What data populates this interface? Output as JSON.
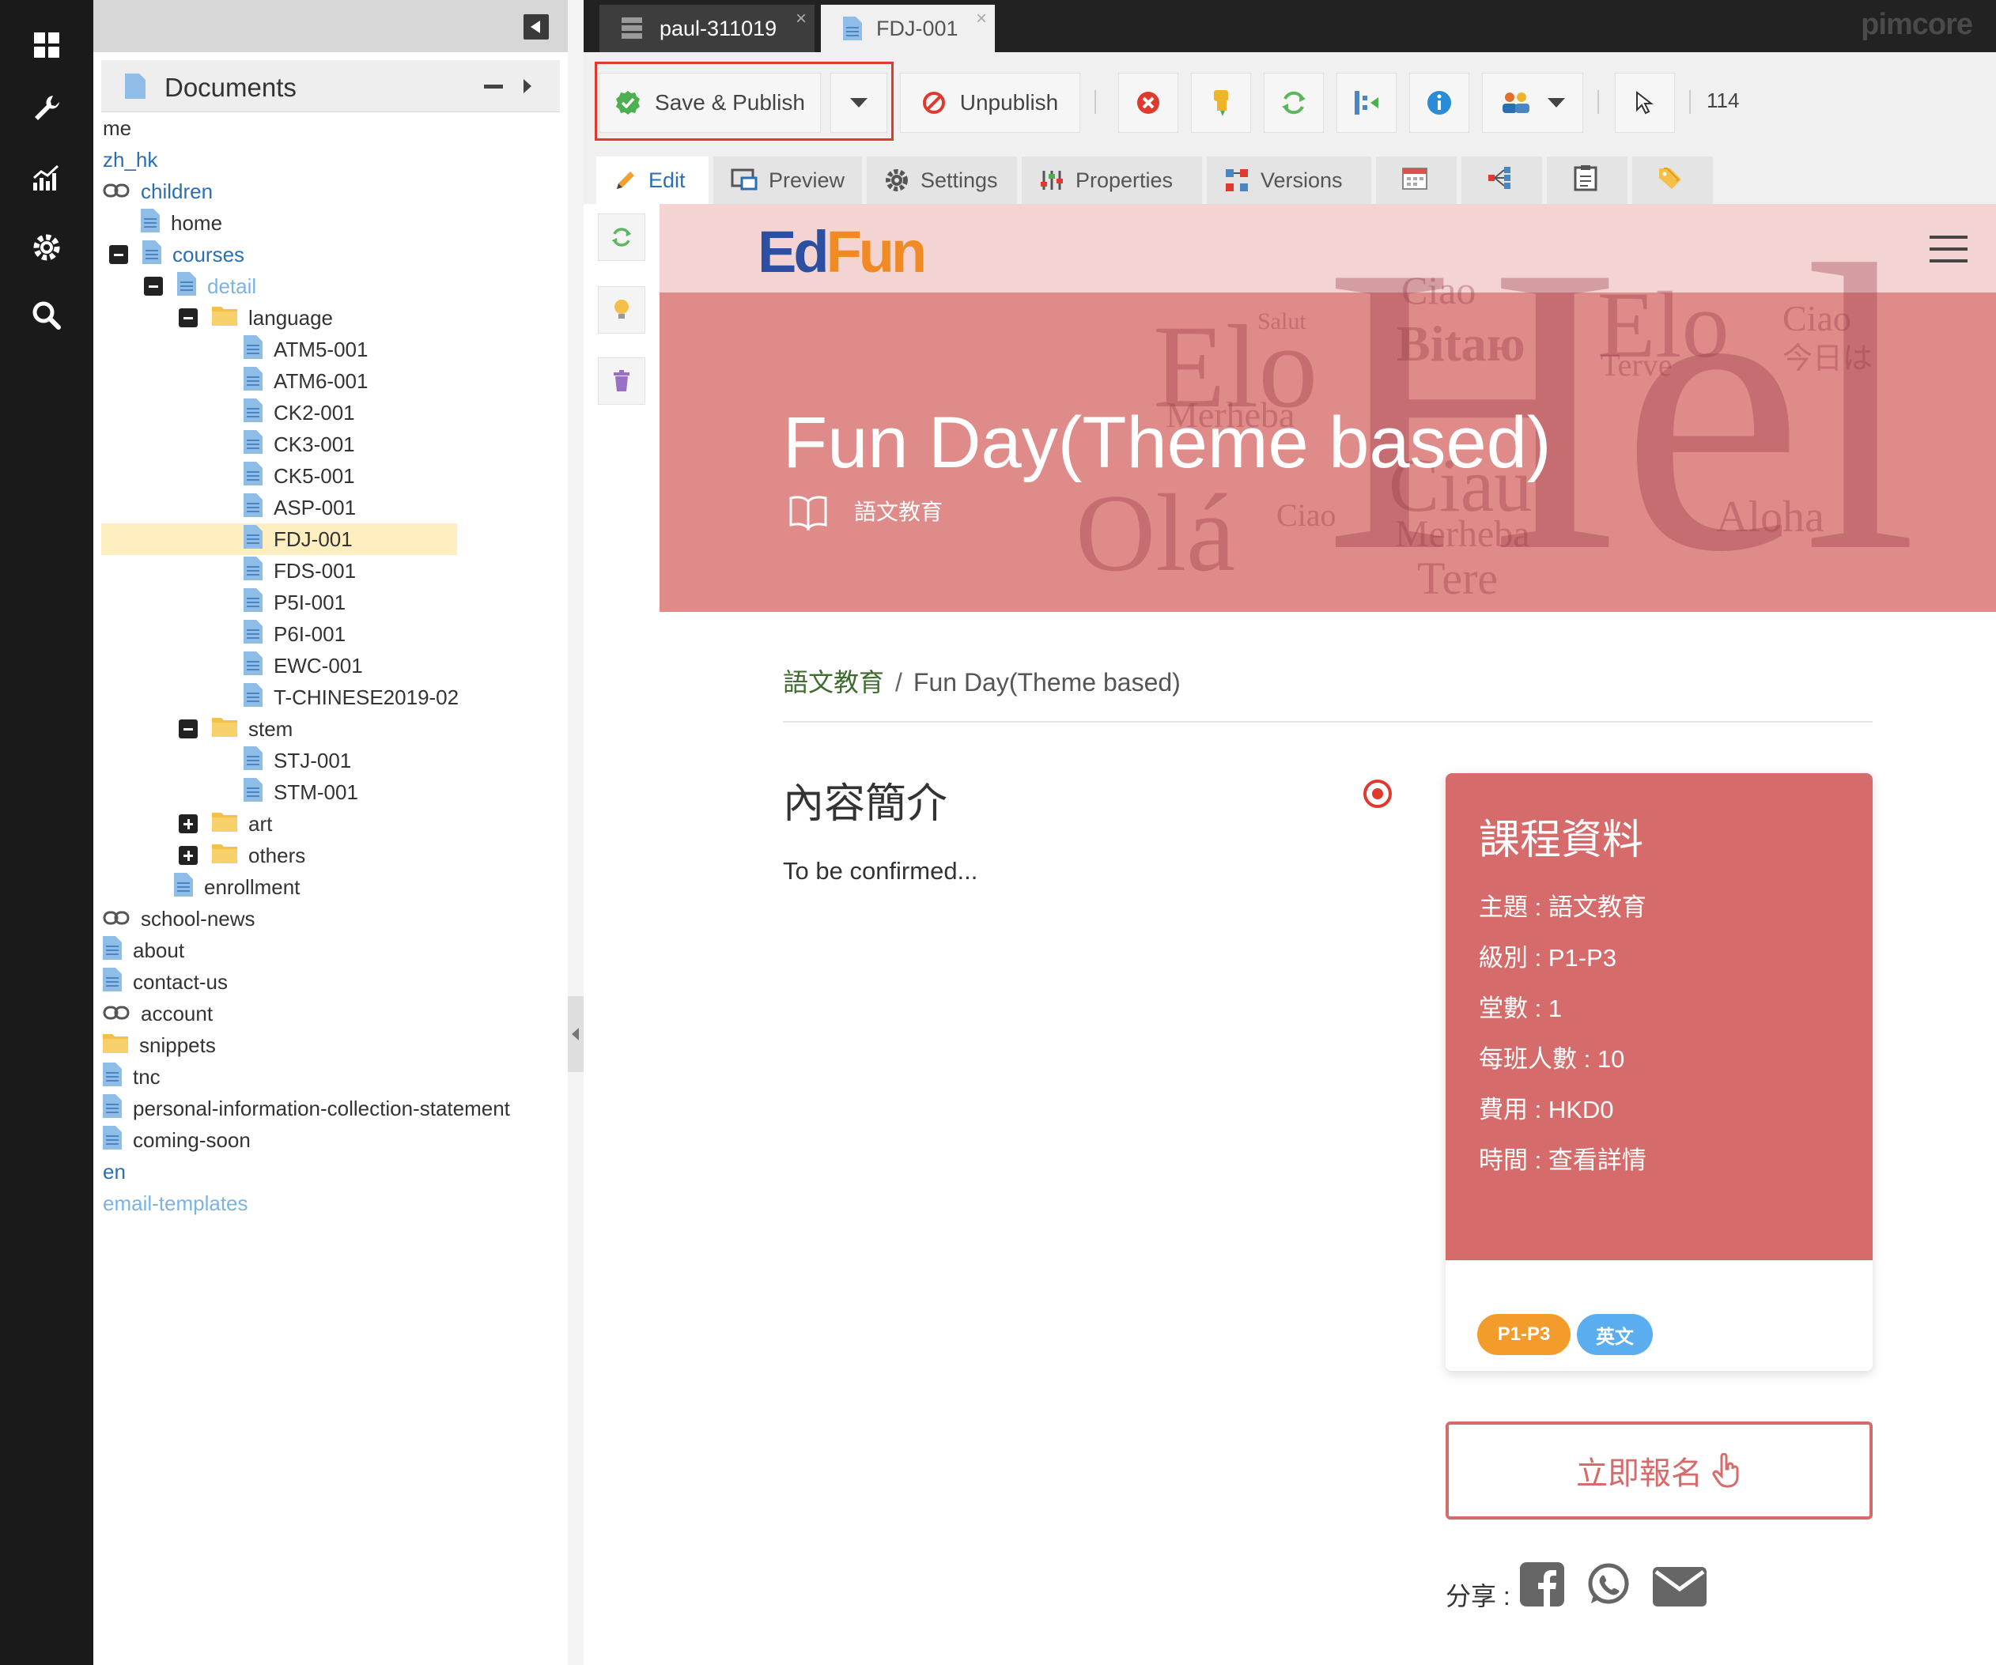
{
  "rail": {
    "items": [
      {
        "icon": "dashboard-grid-icon"
      },
      {
        "icon": "wrench-icon"
      },
      {
        "icon": "analytics-chart-icon"
      },
      {
        "icon": "gear-icon"
      },
      {
        "icon": "search-icon"
      }
    ]
  },
  "tree": {
    "title": "Documents",
    "items": [
      {
        "label": "me",
        "style": "plain"
      },
      {
        "label": "zh_hk",
        "style": "link"
      },
      {
        "label": "children",
        "style": "link",
        "icon": "link-icon"
      },
      {
        "label": "home",
        "style": "plain",
        "icon": "page-icon"
      },
      {
        "label": "courses",
        "style": "link",
        "icon": "page-icon",
        "expander": "minus"
      },
      {
        "label": "detail",
        "style": "light",
        "icon": "page-icon",
        "expander": "minus"
      },
      {
        "label": "language",
        "style": "plain",
        "icon": "folder-icon",
        "expander": "minus"
      },
      {
        "label": "ATM5-001",
        "style": "plain",
        "icon": "page-icon"
      },
      {
        "label": "ATM6-001",
        "style": "plain",
        "icon": "page-icon"
      },
      {
        "label": "CK2-001",
        "style": "plain",
        "icon": "page-icon"
      },
      {
        "label": "CK3-001",
        "style": "plain",
        "icon": "page-icon"
      },
      {
        "label": "CK5-001",
        "style": "plain",
        "icon": "page-icon"
      },
      {
        "label": "ASP-001",
        "style": "plain",
        "icon": "page-icon"
      },
      {
        "label": "FDJ-001",
        "style": "plain",
        "icon": "page-icon",
        "selected": true
      },
      {
        "label": "FDS-001",
        "style": "plain",
        "icon": "page-icon"
      },
      {
        "label": "P5I-001",
        "style": "plain",
        "icon": "page-icon"
      },
      {
        "label": "P6I-001",
        "style": "plain",
        "icon": "page-icon"
      },
      {
        "label": "EWC-001",
        "style": "plain",
        "icon": "page-icon"
      },
      {
        "label": "T-CHINESE2019-02",
        "style": "plain",
        "icon": "page-icon"
      },
      {
        "label": "stem",
        "style": "plain",
        "icon": "folder-icon",
        "expander": "minus"
      },
      {
        "label": "STJ-001",
        "style": "plain",
        "icon": "page-icon"
      },
      {
        "label": "STM-001",
        "style": "plain",
        "icon": "page-icon"
      },
      {
        "label": "art",
        "style": "plain",
        "icon": "folder-icon",
        "expander": "plus"
      },
      {
        "label": "others",
        "style": "plain",
        "icon": "folder-icon",
        "expander": "plus"
      },
      {
        "label": "enrollment",
        "style": "plain",
        "icon": "page-icon"
      },
      {
        "label": "school-news",
        "style": "plain",
        "icon": "link-icon"
      },
      {
        "label": "about",
        "style": "plain",
        "icon": "page-icon"
      },
      {
        "label": "contact-us",
        "style": "plain",
        "icon": "page-icon"
      },
      {
        "label": "account",
        "style": "plain",
        "icon": "link-icon"
      },
      {
        "label": "snippets",
        "style": "plain",
        "icon": "folder-icon"
      },
      {
        "label": "tnc",
        "style": "plain",
        "icon": "page-icon"
      },
      {
        "label": "personal-information-collection-statement",
        "style": "plain",
        "icon": "page-icon"
      },
      {
        "label": "coming-soon",
        "style": "plain",
        "icon": "page-icon"
      },
      {
        "label": "en",
        "style": "link"
      },
      {
        "label": "email-templates",
        "style": "light"
      }
    ]
  },
  "tabs": {
    "items": [
      {
        "label": "paul-311019",
        "icon": "database-icon"
      },
      {
        "label": "FDJ-001",
        "icon": "page-icon"
      }
    ],
    "close_glyph": "×"
  },
  "brand": {
    "name": "pimcore"
  },
  "toolbar": {
    "save_publish_label": "Save & Publish",
    "unpublish_label": "Unpublish",
    "doc_id": "114"
  },
  "edit_tabs": {
    "edit": "Edit",
    "preview": "Preview",
    "settings": "Settings",
    "properties": "Properties",
    "versions": "Versions"
  },
  "page": {
    "logo_a": "Ed",
    "logo_b": "Fun",
    "hero_title": "Fun Day(Theme based)",
    "hero_category": "語文教育",
    "hero_words": [
      "Salut",
      "Ciao",
      "Bitaю",
      "Elo",
      "Ciao",
      "今日は",
      "Terve",
      "Merheba",
      "Elo",
      "Ciau",
      "Olá",
      "Ciao",
      "Aloha",
      "Merheba",
      "Tere",
      "Hel"
    ],
    "breadcrumb": {
      "parent": "語文教育",
      "separator": "/",
      "current": "Fun Day(Theme based)"
    },
    "intro_title": "內容簡介",
    "intro_body": "To be confirmed...",
    "card": {
      "title": "課程資料",
      "rows": [
        "主題 : 語文教育",
        "級別 : P1-P3",
        "堂數 : 1",
        "每班人數 : 10",
        "費用 : HKD0",
        "時間 : 查看詳情"
      ],
      "badges": [
        {
          "label": "P1-P3",
          "color": "#f39c2b"
        },
        {
          "label": "英文",
          "color": "#5aaef0"
        }
      ]
    },
    "enroll_label": "立即報名",
    "share_label": "分享 :"
  },
  "colors": {
    "accent_red": "#d66b6b",
    "selection": "#ffefc0",
    "link_blue": "#2a6fb3"
  }
}
